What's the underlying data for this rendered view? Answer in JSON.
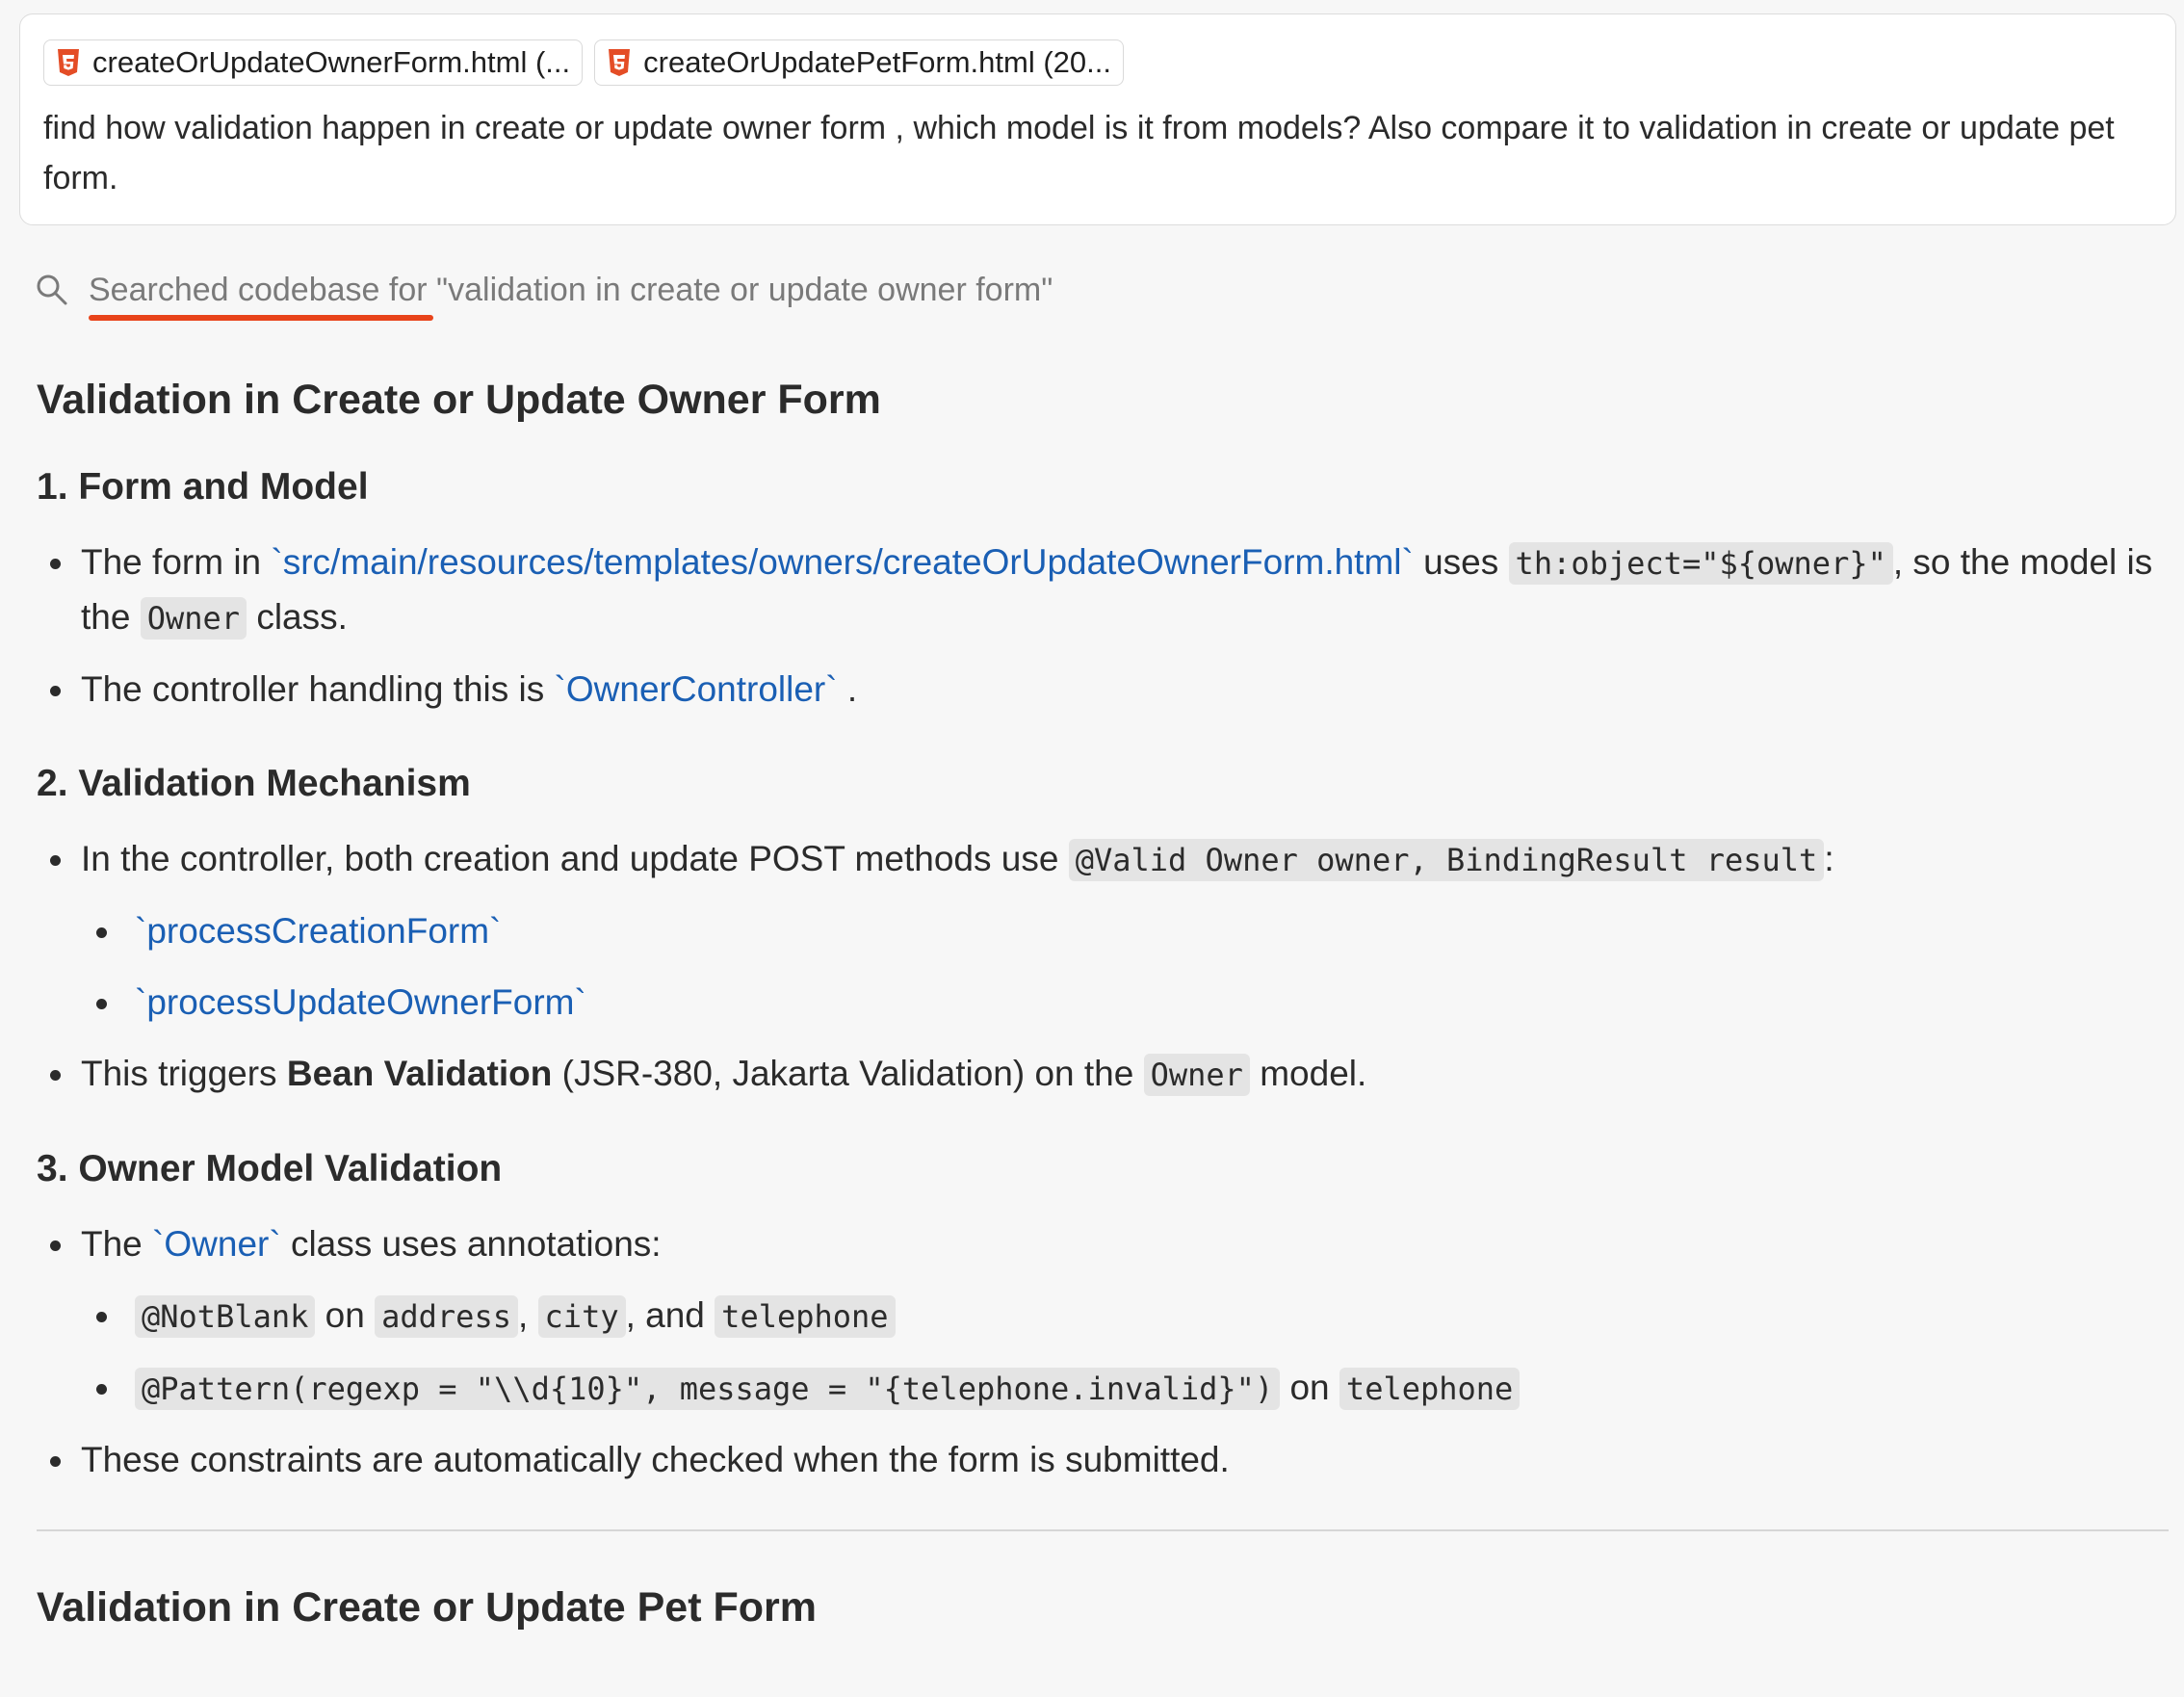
{
  "prompt": {
    "chips": [
      {
        "label": "createOrUpdateOwnerForm.html (...",
        "icon": "html5-icon"
      },
      {
        "label": "createOrUpdatePetForm.html (20...",
        "icon": "html5-icon"
      }
    ],
    "text": "find how validation happen in create or update owner form , which model is it from models? Also compare it to validation in create or update pet form."
  },
  "search": {
    "lead": "Searched codebase for",
    "query": "\"validation in create or update owner form\""
  },
  "colors": {
    "accent_underline": "#e8431a",
    "link": "#1a5fb4",
    "html_icon": "#e44d26"
  },
  "section1": {
    "title": "Validation in Create or Update Owner Form",
    "sub1": {
      "title": "1. Form and Model",
      "b1": {
        "pre": "The form in ",
        "link": "`src/main/resources/templates/owners/createOrUpdateOwnerForm.html`",
        "mid": " uses ",
        "code": "th:object=\"${owner}\"",
        "post1": ", so the model is the ",
        "code2": "Owner",
        "post2": " class."
      },
      "b2": {
        "pre": "The controller handling this is ",
        "link": "`OwnerController`",
        "post": " ."
      }
    },
    "sub2": {
      "title": "2. Validation Mechanism",
      "b1": {
        "pre": "In the controller, both creation and update POST methods use ",
        "code": "@Valid Owner owner, BindingResult result",
        "post": ":"
      },
      "b1a": "`processCreationForm`",
      "b1b": "`processUpdateOwnerForm`",
      "b2": {
        "pre": "This triggers ",
        "bold": "Bean Validation",
        "mid": " (JSR-380, Jakarta Validation) on the ",
        "code": "Owner",
        "post": " model."
      }
    },
    "sub3": {
      "title": "3. Owner Model Validation",
      "b1": {
        "pre": "The ",
        "link": "`Owner`",
        "post": " class uses annotations:"
      },
      "b1a": {
        "code1": "@NotBlank",
        "t1": " on ",
        "code2": "address",
        "t2": ", ",
        "code3": "city",
        "t3": ", and ",
        "code4": "telephone"
      },
      "b1b": {
        "code1": "@Pattern(regexp = \"\\\\d{10}\", message = \"{telephone.invalid}\")",
        "t1": " on ",
        "code2": "telephone"
      },
      "b2": "These constraints are automatically checked when the form is submitted."
    }
  },
  "section2": {
    "title": "Validation in Create or Update Pet Form"
  }
}
